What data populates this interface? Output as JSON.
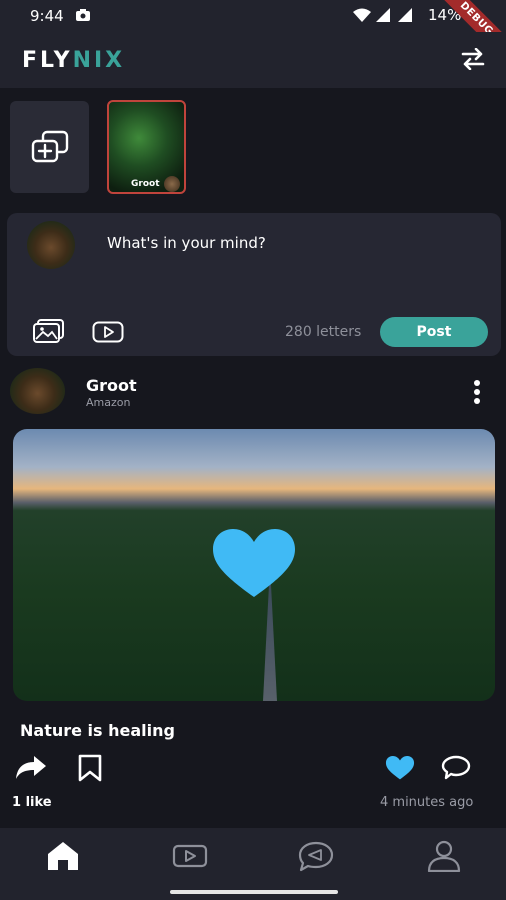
{
  "status_bar": {
    "time": "9:44",
    "battery": "14%",
    "debug_label": "DEBUG"
  },
  "app_bar": {
    "logo_part1": "FLY",
    "logo_part2": "NIX",
    "accent_color": "#3aa39a"
  },
  "stories": {
    "items": [
      {
        "name": "Groot"
      }
    ]
  },
  "composer": {
    "placeholder": "What's in your mind?",
    "letters": "280 letters",
    "post_label": "Post"
  },
  "post": {
    "author": "Groot",
    "subtitle": "Amazon",
    "caption": "Nature is healing",
    "likes": "1 like",
    "time_ago": "4 minutes ago",
    "liked": true,
    "like_color": "#40baf5"
  },
  "bottom_nav": {
    "items": [
      "home-icon",
      "video-icon",
      "chat-icon",
      "profile-icon"
    ],
    "active": 0
  }
}
